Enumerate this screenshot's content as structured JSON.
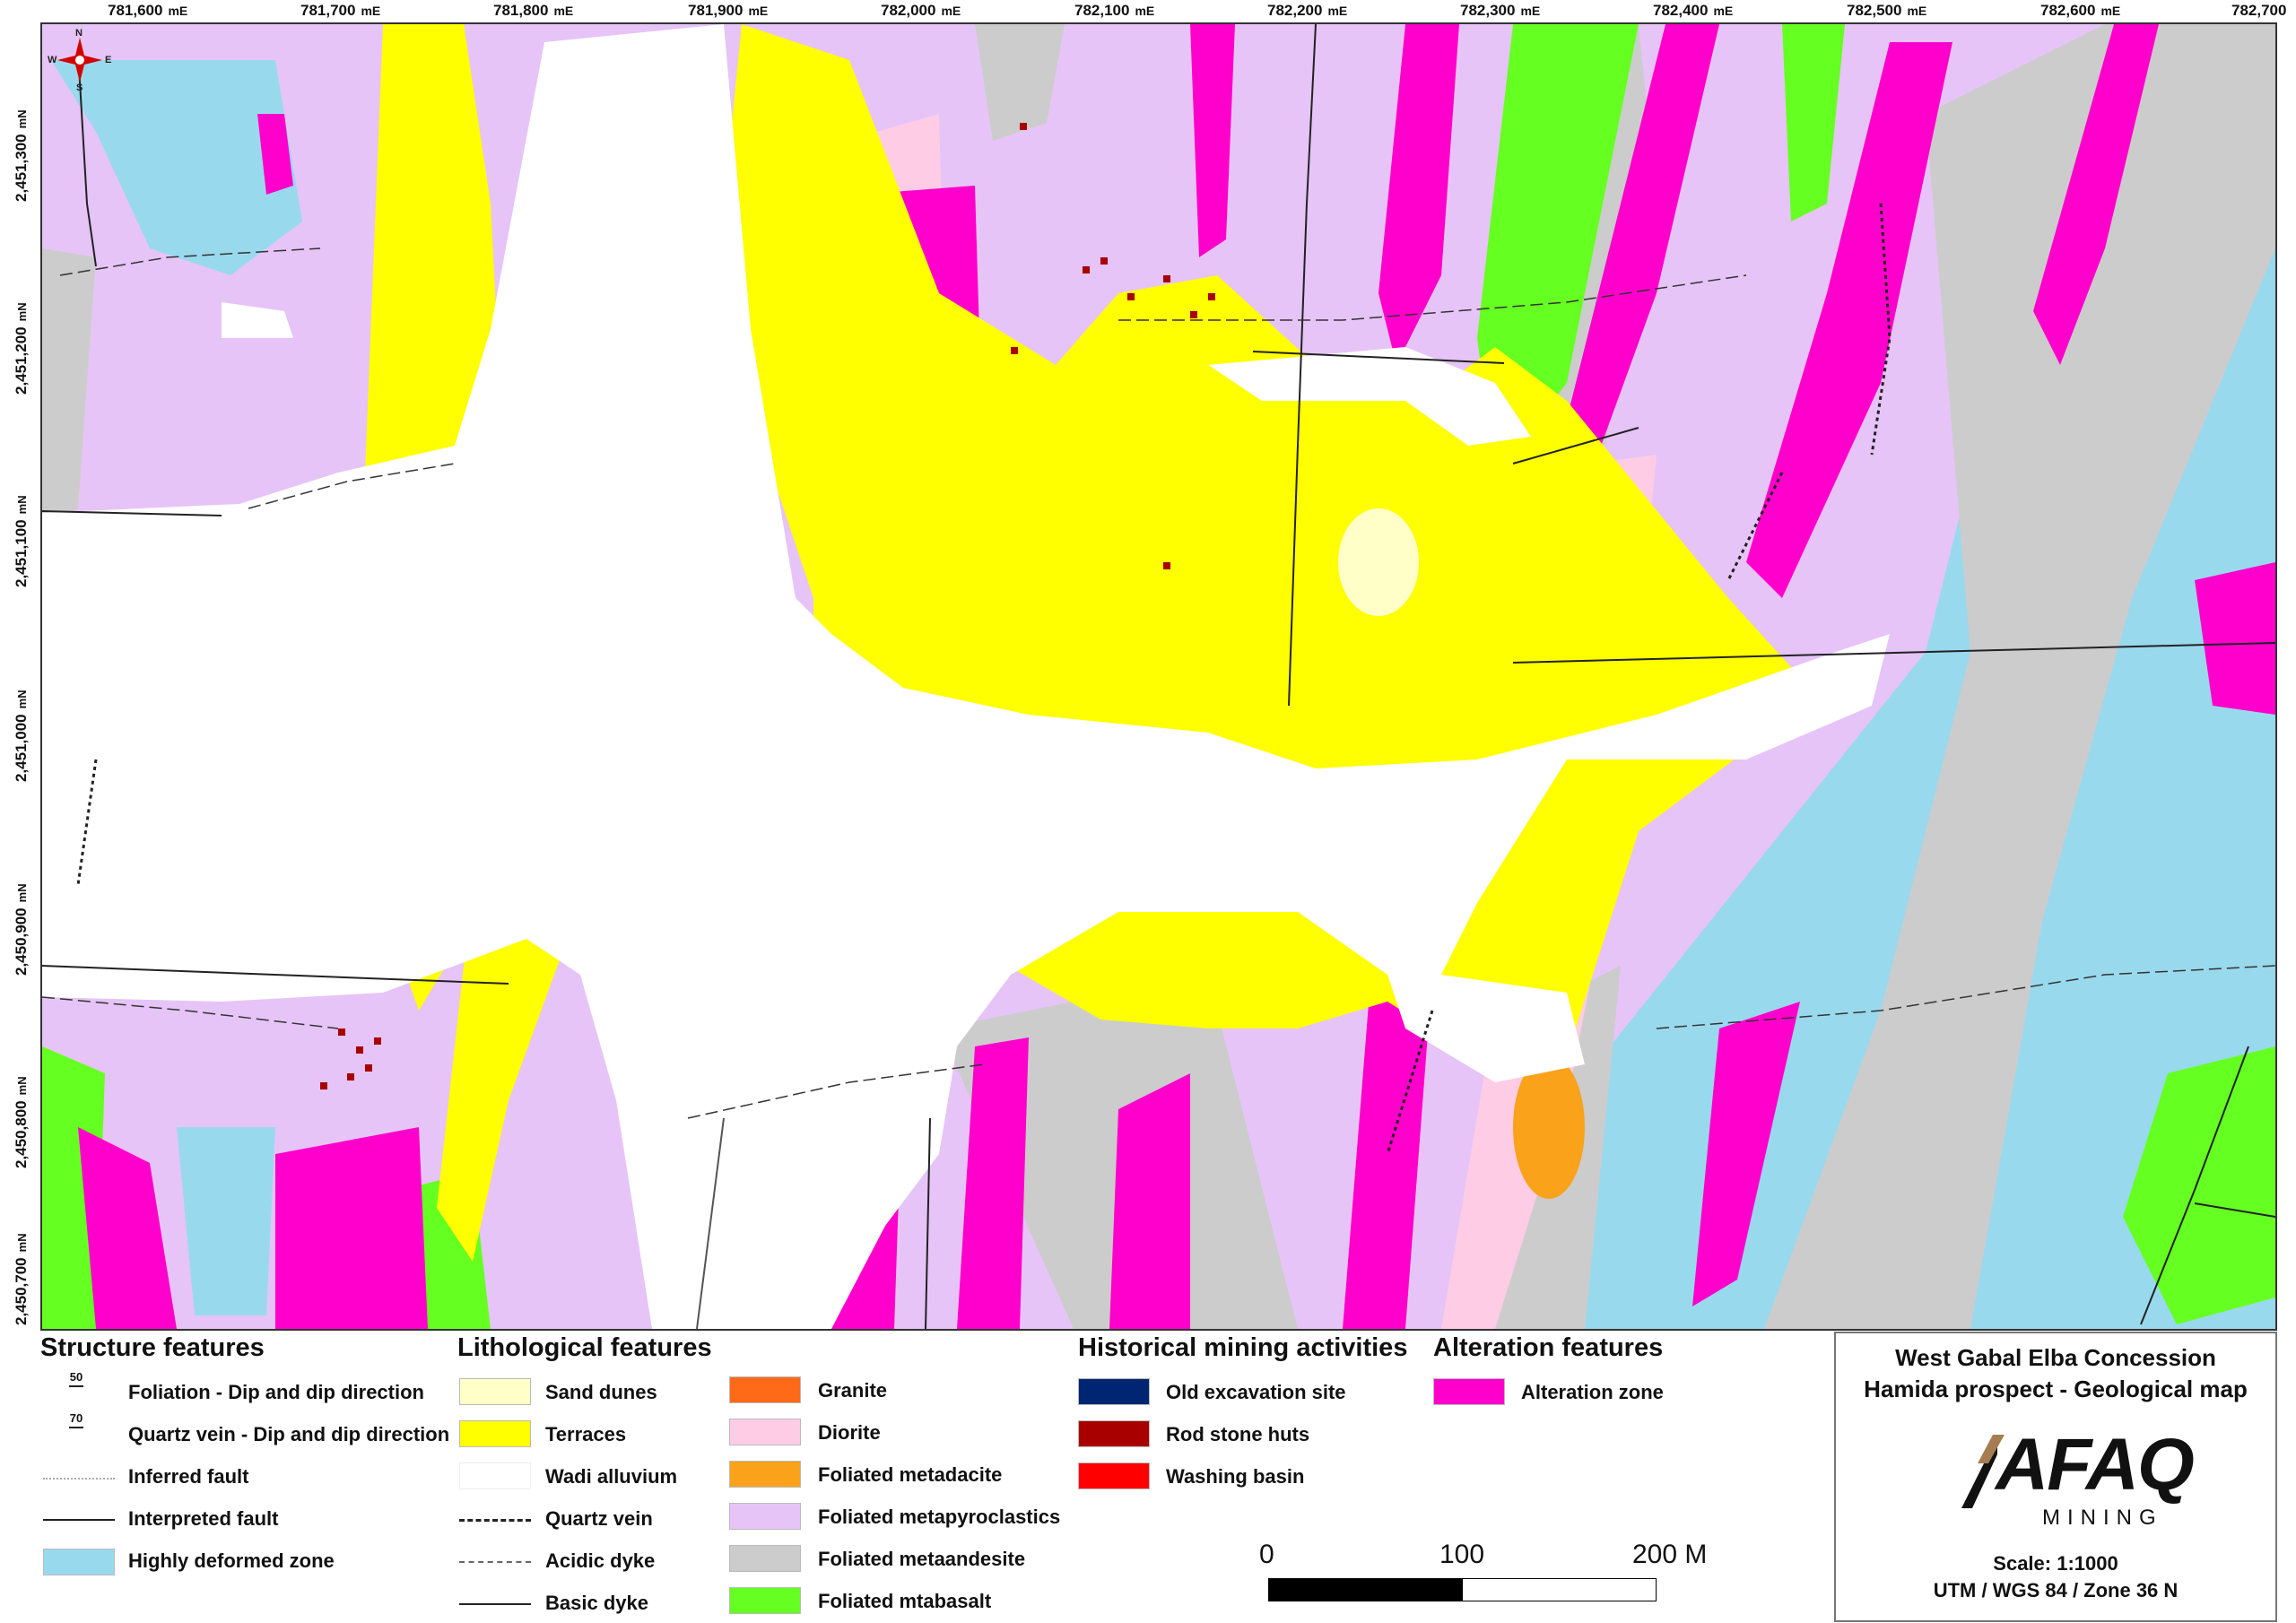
{
  "map": {
    "top_coords": [
      {
        "value": "781,600",
        "unit": "mE"
      },
      {
        "value": "781,700",
        "unit": "mE"
      },
      {
        "value": "781,800",
        "unit": "mE"
      },
      {
        "value": "781,900",
        "unit": "mE"
      },
      {
        "value": "782,000",
        "unit": "mE"
      },
      {
        "value": "782,100",
        "unit": "mE"
      },
      {
        "value": "782,200",
        "unit": "mE"
      },
      {
        "value": "782,300",
        "unit": "mE"
      },
      {
        "value": "782,400",
        "unit": "mE"
      },
      {
        "value": "782,500",
        "unit": "mE"
      },
      {
        "value": "782,600",
        "unit": "mE"
      },
      {
        "value": "782,700",
        "unit": ""
      }
    ],
    "left_coords": [
      {
        "value": "2,451,300",
        "unit": "mN"
      },
      {
        "value": "2,451,200",
        "unit": "mN"
      },
      {
        "value": "2,451,100",
        "unit": "mN"
      },
      {
        "value": "2,451,000",
        "unit": "mN"
      },
      {
        "value": "2,450,900",
        "unit": "mN"
      },
      {
        "value": "2,450,800",
        "unit": "mN"
      },
      {
        "value": "2,450,700",
        "unit": "mN"
      }
    ],
    "compass": {
      "n": "N",
      "s": "S",
      "e": "E",
      "w": "W"
    },
    "colors": {
      "alteration": "#ff00cc",
      "terraces": "#ffff00",
      "metapyroclastics": "#e6c4f7",
      "highly_deformed": "#99d9ee",
      "metaandesite": "#cccccc",
      "metabasalt": "#66ff22",
      "diorite": "#ffcce5",
      "metadacite": "#f9a21a",
      "sand_dunes": "#ffffc8",
      "granite": "#ff6a19",
      "old_excavation": "#002673",
      "rod_huts": "#a80000",
      "washing_basin": "#ff0000",
      "wadi": "#ffffff"
    }
  },
  "legend": {
    "structure": {
      "heading": "Structure features",
      "foliation_num": "50",
      "quartz_num": "70",
      "items": [
        "Foliation - Dip and dip direction",
        "Quartz vein - Dip and dip direction",
        "Inferred fault",
        "Interpreted fault",
        "Highly deformed zone"
      ]
    },
    "lithology": {
      "heading": "Lithological features",
      "col1": [
        "Sand dunes",
        "Terraces",
        "Wadi alluvium",
        "Quartz vein",
        "Acidic dyke",
        "Basic dyke"
      ],
      "col2": [
        "Granite",
        "Diorite",
        "Foliated metadacite",
        "Foliated metapyroclastics",
        "Foliated metaandesite",
        "Foliated mtabasalt"
      ]
    },
    "mining": {
      "heading": "Historical mining activities",
      "items": [
        "Old excavation site",
        "Rod stone huts",
        "Washing basin"
      ]
    },
    "alteration": {
      "heading": "Alteration features",
      "items": [
        "Alteration zone"
      ]
    }
  },
  "scalebar": {
    "labels": [
      "0",
      "100",
      "200 M"
    ]
  },
  "info": {
    "title1": "West Gabal Elba Concession",
    "title2": "Hamida prospect -  Geological map",
    "logo_text": "AFAQ",
    "logo_sub": "MINING",
    "scale": "Scale:  1:1000",
    "projection": "UTM / WGS 84 / Zone 36 N"
  }
}
